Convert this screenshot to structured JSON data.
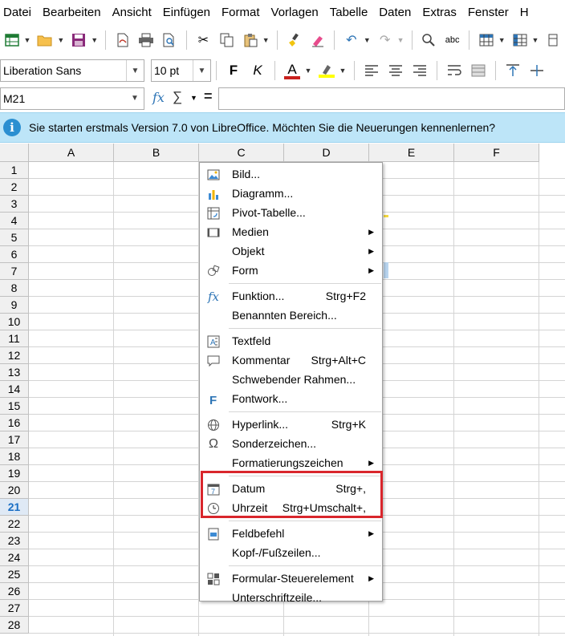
{
  "menubar": {
    "items": [
      "Datei",
      "Bearbeiten",
      "Ansicht",
      "Einfügen",
      "Format",
      "Vorlagen",
      "Tabelle",
      "Daten",
      "Extras",
      "Fenster",
      "H"
    ]
  },
  "toolbar2": {
    "font_name": "Liberation Sans",
    "font_size": "10 pt",
    "bold": "F",
    "italic": "K",
    "font_color_glyph": "A"
  },
  "formulabar": {
    "namebox": "M21",
    "fx": "fx",
    "sum": "∑",
    "equals": "="
  },
  "infobar": {
    "text": "Sie starten erstmals Version 7.0 von LibreOffice. Möchten Sie die Neuerungen kennenlernen?",
    "icon_glyph": "i"
  },
  "sheet": {
    "columns": [
      "A",
      "B",
      "C",
      "D",
      "E",
      "F"
    ],
    "rows": [
      "1",
      "2",
      "3",
      "4",
      "5",
      "6",
      "7",
      "8",
      "9",
      "10",
      "11",
      "12",
      "13",
      "14",
      "15",
      "16",
      "17",
      "18",
      "19",
      "20",
      "21",
      "22",
      "23",
      "24",
      "25",
      "26",
      "27",
      "28"
    ],
    "active_row": "21"
  },
  "context_menu": {
    "items": [
      {
        "label": "Bild...",
        "shortcut": "",
        "submenu": false,
        "icon": "image-icon"
      },
      {
        "label": "Diagramm...",
        "shortcut": "",
        "submenu": false,
        "icon": "chart-icon"
      },
      {
        "label": "Pivot-Tabelle...",
        "shortcut": "",
        "submenu": false,
        "icon": "pivot-table-icon"
      },
      {
        "label": "Medien",
        "shortcut": "",
        "submenu": true,
        "icon": "media-icon"
      },
      {
        "label": "Objekt",
        "shortcut": "",
        "submenu": true,
        "icon": ""
      },
      {
        "label": "Form",
        "shortcut": "",
        "submenu": true,
        "icon": "shapes-icon"
      },
      {
        "label": "Funktion...",
        "shortcut": "Strg+F2",
        "submenu": false,
        "icon": "function-icon"
      },
      {
        "label": "Benannten Bereich...",
        "shortcut": "",
        "submenu": false,
        "icon": ""
      },
      {
        "label": "Textfeld",
        "shortcut": "",
        "submenu": false,
        "icon": "text-box-icon"
      },
      {
        "label": "Kommentar",
        "shortcut": "Strg+Alt+C",
        "submenu": false,
        "icon": "comment-icon"
      },
      {
        "label": "Schwebender Rahmen...",
        "shortcut": "",
        "submenu": false,
        "icon": ""
      },
      {
        "label": "Fontwork...",
        "shortcut": "",
        "submenu": false,
        "icon": "fontwork-icon"
      },
      {
        "label": "Hyperlink...",
        "shortcut": "Strg+K",
        "submenu": false,
        "icon": "hyperlink-icon"
      },
      {
        "label": "Sonderzeichen...",
        "shortcut": "",
        "submenu": false,
        "icon": "special-character-icon"
      },
      {
        "label": "Formatierungszeichen",
        "shortcut": "",
        "submenu": true,
        "icon": ""
      },
      {
        "label": "Datum",
        "shortcut": "Strg+,",
        "submenu": false,
        "icon": "calendar-icon"
      },
      {
        "label": "Uhrzeit",
        "shortcut": "Strg+Umschalt+,",
        "submenu": false,
        "icon": "clock-icon"
      },
      {
        "label": "Feldbefehl",
        "shortcut": "",
        "submenu": true,
        "icon": "field-icon"
      },
      {
        "label": "Kopf-/Fußzeilen...",
        "shortcut": "",
        "submenu": false,
        "icon": ""
      },
      {
        "label": "Formular-Steuerelement",
        "shortcut": "",
        "submenu": true,
        "icon": "form-control-icon"
      },
      {
        "label": "Unterschriftzeile...",
        "shortcut": "",
        "submenu": false,
        "icon": ""
      }
    ]
  },
  "colors": {
    "highlight": "#d9262c",
    "infobar_bg": "#bde5f8",
    "active_row": "#1a6ec4"
  }
}
